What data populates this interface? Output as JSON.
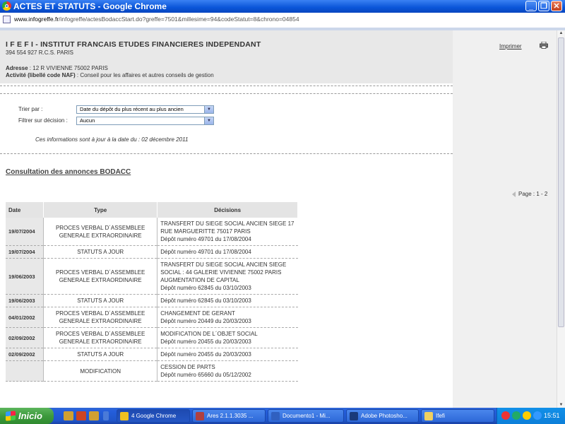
{
  "window": {
    "title": "ACTES ET STATUTS - Google Chrome",
    "minimize_icon": "_",
    "maximize_icon": "❐",
    "close_icon": "✕"
  },
  "browser": {
    "url_host": "www.infogreffe.fr",
    "url_path": "/infogreffe/actesBodaccStart.do?greffe=7501&millesime=94&codeStatut=8&chrono=04854"
  },
  "company": {
    "name": "I F E F I - INSTITUT FRANCAIS ETUDES FINANCIERES INDEPENDANT",
    "rcs": "394 554 927 R.C.S. PARIS",
    "address_label": "Adresse",
    "address_value": " : 12 R VIVIENNE 75002 PARIS",
    "activity_label": "Activité (libellé code NAF)",
    "activity_value": " : Conseil pour les affaires et autres conseils de gestion"
  },
  "actions": {
    "print_label": "Imprimer"
  },
  "filters": {
    "sort_label": "Trier par :",
    "sort_value": "Date du dépôt du plus récent au plus ancien",
    "filter_label": "Filtrer sur décision :",
    "filter_value": "Aucun"
  },
  "as_of": "Ces informations sont à jour à la date du : 02 décembre 2011",
  "section_title": "Consultation des annonces BODACC",
  "pagination": "Page : 1 - 2",
  "table": {
    "headers": [
      "Date",
      "Type",
      "Décisions"
    ],
    "rows": [
      {
        "date": "19/07/2004",
        "type": [
          "PROCES VERBAL D´ASSEMBLEE",
          "GENERALE EXTRAORDINAIRE"
        ],
        "decisions": [
          "TRANSFERT DU SIEGE SOCIAL ANCIEN SIEGE 17",
          "RUE MARGUERITTE 75017 PARIS",
          "Dépôt numéro 49701 du 17/08/2004"
        ]
      },
      {
        "date": "19/07/2004",
        "type": [
          "STATUTS A JOUR"
        ],
        "decisions": [
          "Dépôt numéro 49701 du 17/08/2004"
        ]
      },
      {
        "date": "19/06/2003",
        "type": [
          "PROCES VERBAL D´ASSEMBLEE",
          "GENERALE EXTRAORDINAIRE"
        ],
        "decisions": [
          "TRANSFERT DU SIEGE SOCIAL ANCIEN SIEGE",
          "SOCIAL : 44 GALERIE VIVIENNE 75002 PARIS",
          "AUGMENTATION DE CAPITAL",
          "Dépôt numéro 62845 du 03/10/2003"
        ]
      },
      {
        "date": "19/06/2003",
        "type": [
          "STATUTS A JOUR"
        ],
        "decisions": [
          "Dépôt numéro 62845 du 03/10/2003"
        ]
      },
      {
        "date": "04/01/2002",
        "type": [
          "PROCES VERBAL D´ASSEMBLEE",
          "GENERALE EXTRAORDINAIRE"
        ],
        "decisions": [
          "CHANGEMENT DE GERANT",
          "Dépôt numéro 20449 du 20/03/2003"
        ]
      },
      {
        "date": "02/09/2002",
        "type": [
          "PROCES VERBAL D´ASSEMBLEE",
          "GENERALE EXTRAORDINAIRE"
        ],
        "decisions": [
          "MODIFICATION DE L´OBJET SOCIAL",
          "Dépôt numéro 20455 du 20/03/2003"
        ]
      },
      {
        "date": "02/09/2002",
        "type": [
          "STATUTS A JOUR"
        ],
        "decisions": [
          "Dépôt numéro 20455 du 20/03/2003"
        ]
      },
      {
        "date": "",
        "type": [
          "MODIFICATION"
        ],
        "decisions": [
          "CESSION DE PARTS",
          "Dépôt numéro 65660 du 05/12/2002"
        ]
      }
    ]
  },
  "taskbar": {
    "start_label": "Inicio",
    "tasks": [
      {
        "label": "4 Google Chrome",
        "icon": "chrome-icon",
        "color": "#f0c020"
      },
      {
        "label": "Ares 2.1.1.3035 ...",
        "icon": "ares-icon",
        "color": "#b04040"
      },
      {
        "label": "Documento1 - Mi...",
        "icon": "word-icon",
        "color": "#3060c0"
      },
      {
        "label": "Adobe Photosho...",
        "icon": "photoshop-icon",
        "color": "#1a3a7a"
      },
      {
        "label": "Ifefi",
        "icon": "folder-icon",
        "color": "#f0d060"
      }
    ],
    "clock": "15:51"
  }
}
